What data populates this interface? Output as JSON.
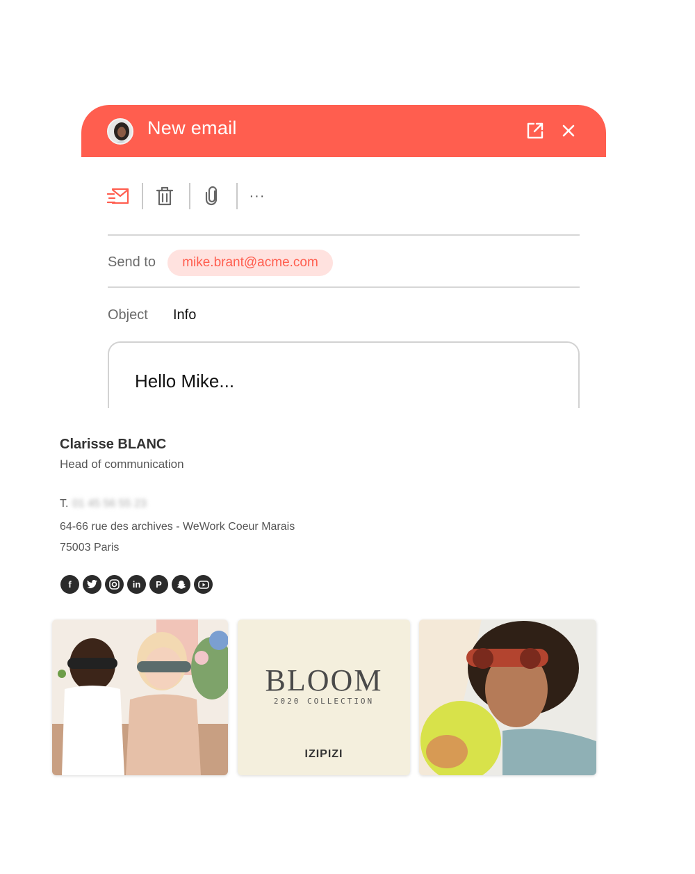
{
  "window": {
    "title": "New email",
    "icons": {
      "avatar": "user-avatar",
      "popout": "external-link-icon",
      "close": "close-icon"
    },
    "accent": "#ff5e4f"
  },
  "toolbar": {
    "icons": [
      "send-icon",
      "trash-icon",
      "attachment-icon",
      "more-icon"
    ],
    "more_label": "···"
  },
  "compose": {
    "sendto_label": "Send to",
    "recipient": "mike.brant@acme.com",
    "object_label": "Object",
    "object_value": "Info",
    "body": "Hello Mike..."
  },
  "signature": {
    "name": "Clarisse BLANC",
    "role": "Head of communication",
    "phone_prefix": "T.",
    "phone_blurred": "01 45 56 55 23",
    "address_line1": "64-66 rue des archives - WeWork Coeur Marais",
    "address_line2": "75003 Paris",
    "socials": [
      "facebook-icon",
      "twitter-icon",
      "instagram-icon",
      "linkedin-icon",
      "pinterest-icon",
      "snapchat-icon",
      "youtube-icon"
    ]
  },
  "banners": {
    "center_title": "BLOOM",
    "center_subtitle": "2020 COLLECTION",
    "center_brand": "IZIPIZI"
  }
}
